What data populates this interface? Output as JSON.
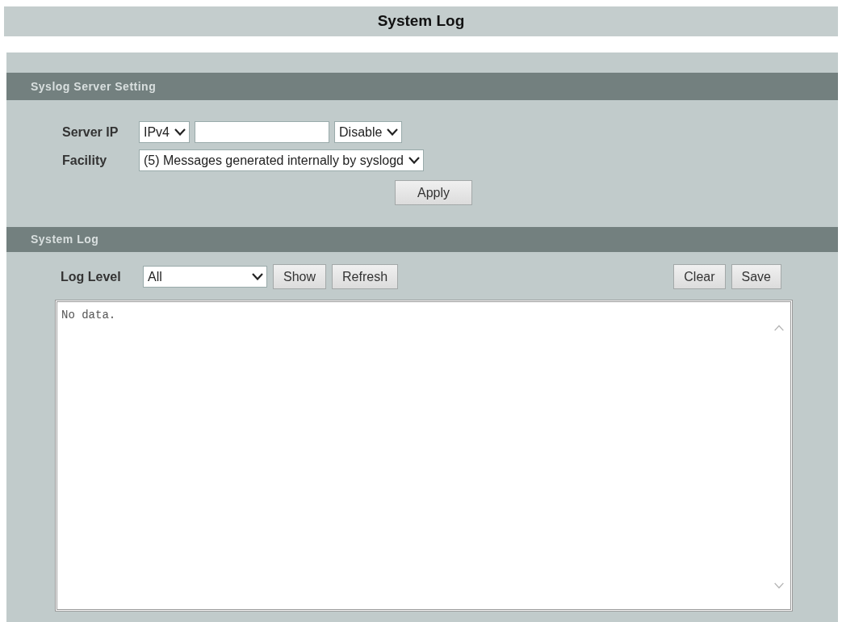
{
  "page_title": "System Log",
  "syslog_server_setting": {
    "header": "Syslog Server Setting",
    "server_ip": {
      "label": "Server IP",
      "ip_version": "IPv4",
      "mode": "Disable"
    },
    "facility": {
      "label": "Facility",
      "value": "(5) Messages generated internally by syslogd"
    },
    "apply_button": "Apply"
  },
  "system_log": {
    "header": "System Log",
    "log_level": {
      "label": "Log Level",
      "value": "All"
    },
    "left_buttons": [
      "Show",
      "Refresh"
    ],
    "right_buttons": [
      "Clear",
      "Save"
    ],
    "log_text": "No data."
  }
}
